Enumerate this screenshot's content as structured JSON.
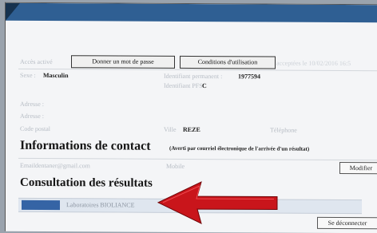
{
  "header": {
    "access_label": "Accès activé",
    "change_password": "Donner un mot de passe",
    "terms": "Conditions d'utilisation",
    "accepted": "acceptées le 10/02/2016 16:5"
  },
  "identity": {
    "sex_label": "Sexe :",
    "sex_value": "Masculin",
    "permanent_id_label": "Identifiant permanent :",
    "permanent_id_value": "1977594",
    "pfs_id_label": "Identifiant PFS",
    "pfs_id_value": "C"
  },
  "address": {
    "line1_label": "Adresse :",
    "line2_label": "Adresse :",
    "postal_label": "Code postal",
    "city_label": "Ville",
    "city_value": "REZE",
    "phone_label": "Téléphone"
  },
  "contact": {
    "title": "Informations de contact",
    "notice": "(Averti par courriel électronique de l'arrivée d'un résultat)",
    "email_label": "Email",
    "email_value": "dentaner@gmail.com",
    "mobile_label": "Mobile",
    "modify_button": "Modifier"
  },
  "results": {
    "title": "Consultation des résultats",
    "lab_name": "Laboratoires BIOLIANCE",
    "disconnect_button": "Se déconnecter"
  }
}
